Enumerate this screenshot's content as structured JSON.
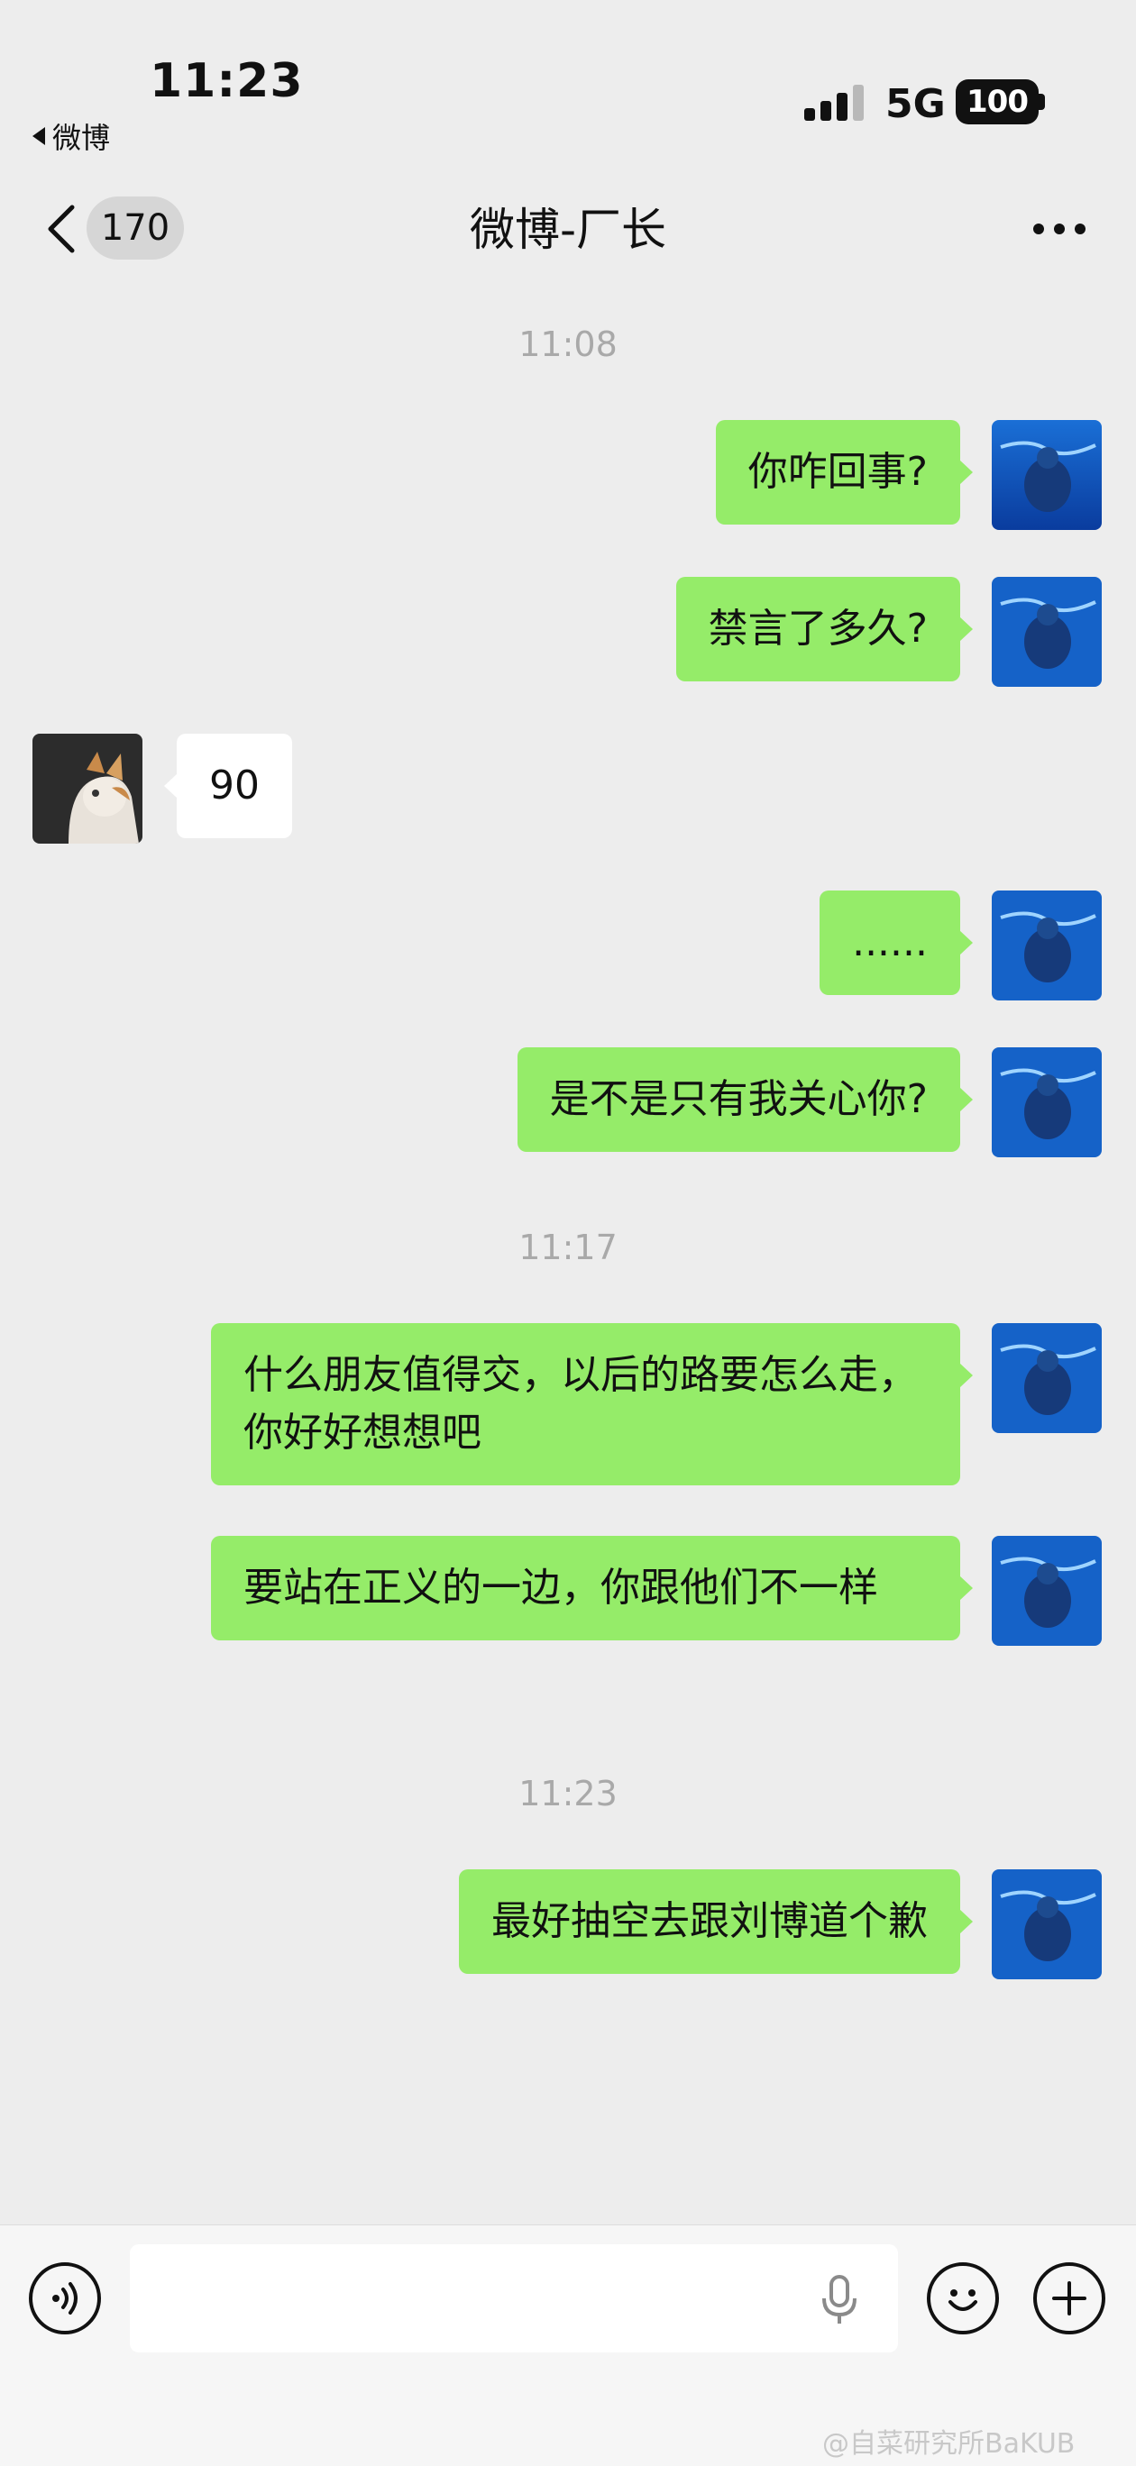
{
  "status_bar": {
    "time": "11:23",
    "back_app": "微博",
    "network": "5G",
    "battery": "100"
  },
  "nav": {
    "unread_count": "170",
    "title": "微博-厂长"
  },
  "messages": [
    {
      "type": "timestamp",
      "text": "11:08"
    },
    {
      "type": "sent",
      "text": "你咋回事?"
    },
    {
      "type": "sent",
      "text": "禁言了多久?"
    },
    {
      "type": "received",
      "text": "90"
    },
    {
      "type": "sent",
      "text": "......"
    },
    {
      "type": "sent",
      "text": "是不是只有我关心你?"
    },
    {
      "type": "timestamp",
      "text": "11:17"
    },
    {
      "type": "sent",
      "text": "什么朋友值得交，以后的路要怎么走，你好好想想吧"
    },
    {
      "type": "sent",
      "text": "要站在正义的一边，你跟他们不一样"
    },
    {
      "type": "timestamp",
      "text": "11:23"
    },
    {
      "type": "sent",
      "text": "最好抽空去跟刘博道个歉"
    }
  ],
  "input": {
    "placeholder": ""
  },
  "icons": {
    "voice": "voice-icon",
    "mic": "mic-icon",
    "emoji": "emoji-icon",
    "plus": "plus-icon"
  },
  "watermark": "@自菜研究所BaKUB",
  "colors": {
    "sent_bubble": "#95ec69",
    "received_bubble": "#ffffff",
    "background": "#ededed"
  }
}
